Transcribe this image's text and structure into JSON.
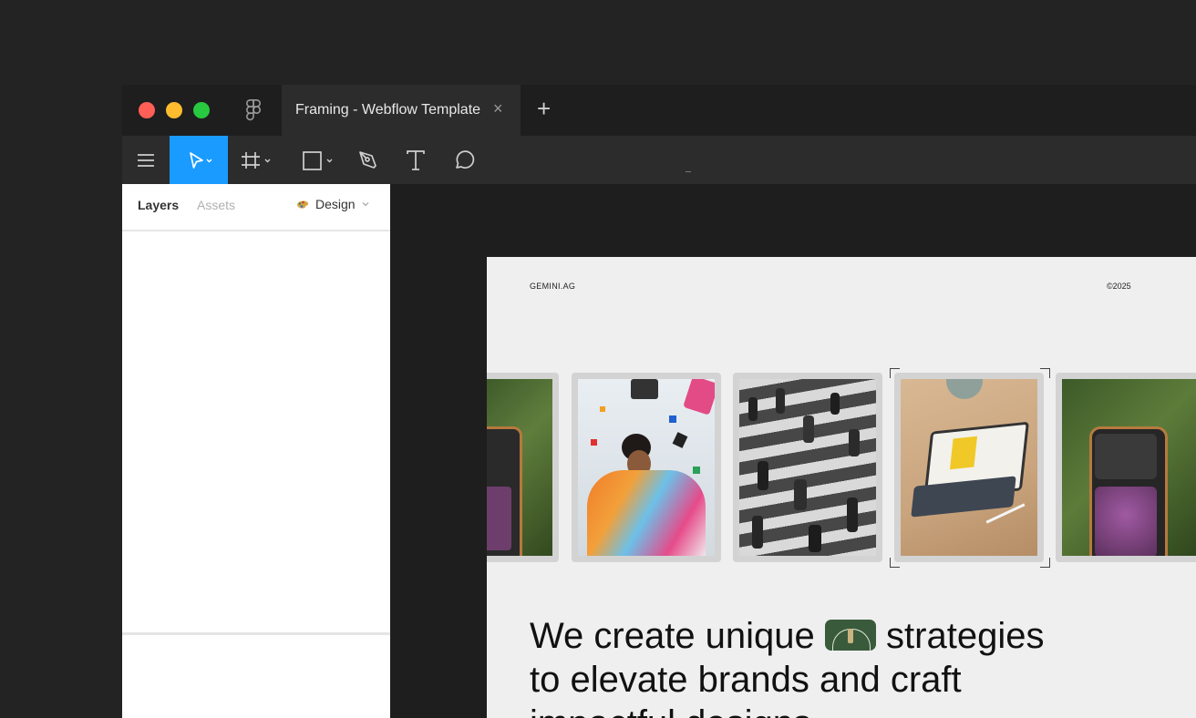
{
  "titlebar": {
    "tab_title": "Framing - Webflow Template",
    "close_glyph": "×",
    "new_tab_glyph": "+"
  },
  "panel": {
    "tab_layers": "Layers",
    "tab_assets": "Assets",
    "design_label": "Design"
  },
  "frame": {
    "logo": "GEMINI.AG",
    "copyright": "©2025",
    "headline_line1_a": "We create unique",
    "headline_line1_b": "strategies",
    "headline_line2": "to elevate brands and craft",
    "headline_line3": "impactful designs"
  },
  "colors": {
    "accent": "#1a9bff",
    "canvas_bg": "#1e1e1e",
    "frame_bg": "#efefef"
  },
  "icons": [
    "figma-logo-icon",
    "menu-icon",
    "move-tool-icon",
    "frame-tool-icon",
    "shape-tool-icon",
    "pen-tool-icon",
    "text-tool-icon",
    "comment-tool-icon",
    "design-palette-icon",
    "chevron-down-icon"
  ]
}
